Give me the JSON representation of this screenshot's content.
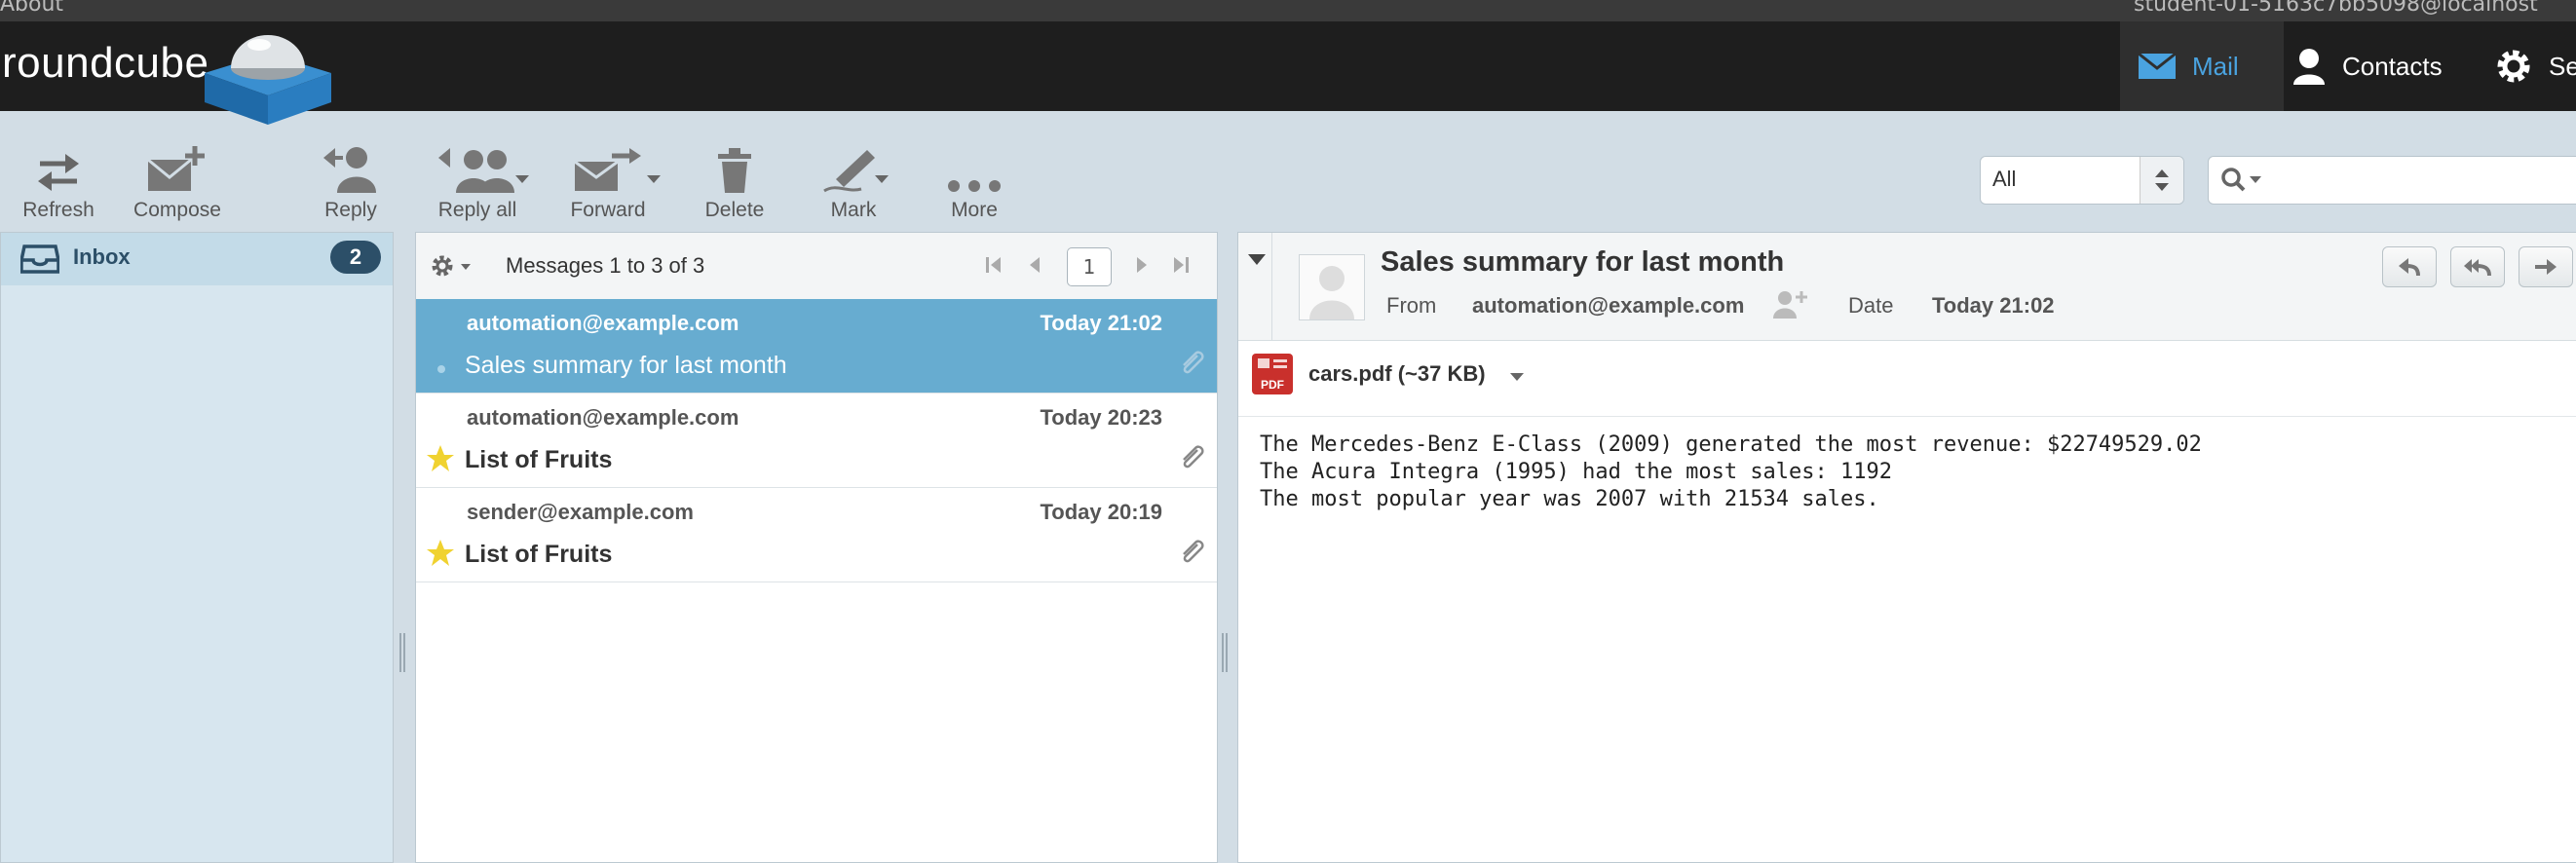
{
  "topbar": {
    "about_label": "About",
    "user_label": "student-01-5163c7bb5098@localhost"
  },
  "header": {
    "logo_text": "roundcube",
    "nav": {
      "mail": "Mail",
      "contacts": "Contacts",
      "settings": "Se"
    }
  },
  "toolbar": {
    "refresh": "Refresh",
    "compose": "Compose",
    "reply": "Reply",
    "reply_all": "Reply all",
    "forward": "Forward",
    "delete": "Delete",
    "mark": "Mark",
    "more": "More"
  },
  "filter": {
    "value": "All"
  },
  "search": {
    "placeholder": ""
  },
  "folders": {
    "inbox": {
      "label": "Inbox",
      "unread": "2"
    }
  },
  "message_list": {
    "count_text": "Messages 1 to 3 of 3",
    "page": "1",
    "messages": [
      {
        "from": "automation@example.com",
        "date": "Today 21:02",
        "subject": "Sales summary for last month"
      },
      {
        "from": "automation@example.com",
        "date": "Today 20:23",
        "subject": "List of Fruits"
      },
      {
        "from": "sender@example.com",
        "date": "Today 20:19",
        "subject": "List of Fruits"
      }
    ]
  },
  "preview": {
    "subject": "Sales summary for last month",
    "from_label": "From",
    "from": "automation@example.com",
    "date_label": "Date",
    "date": "Today 21:02",
    "attachment": "cars.pdf (~37 KB)",
    "attachment_icon_text": "PDF",
    "body": [
      "The Mercedes-Benz E-Class (2009) generated the most revenue: $22749529.02",
      "The Acura Integra (1995) had the most sales: 1192",
      "The most popular year was 2007 with 21534 sales."
    ]
  },
  "colors": {
    "accent": "#4aa3e0",
    "selected_row": "#67acd0",
    "header_bg": "#1e1e1e",
    "badge": "#2c4f68"
  }
}
